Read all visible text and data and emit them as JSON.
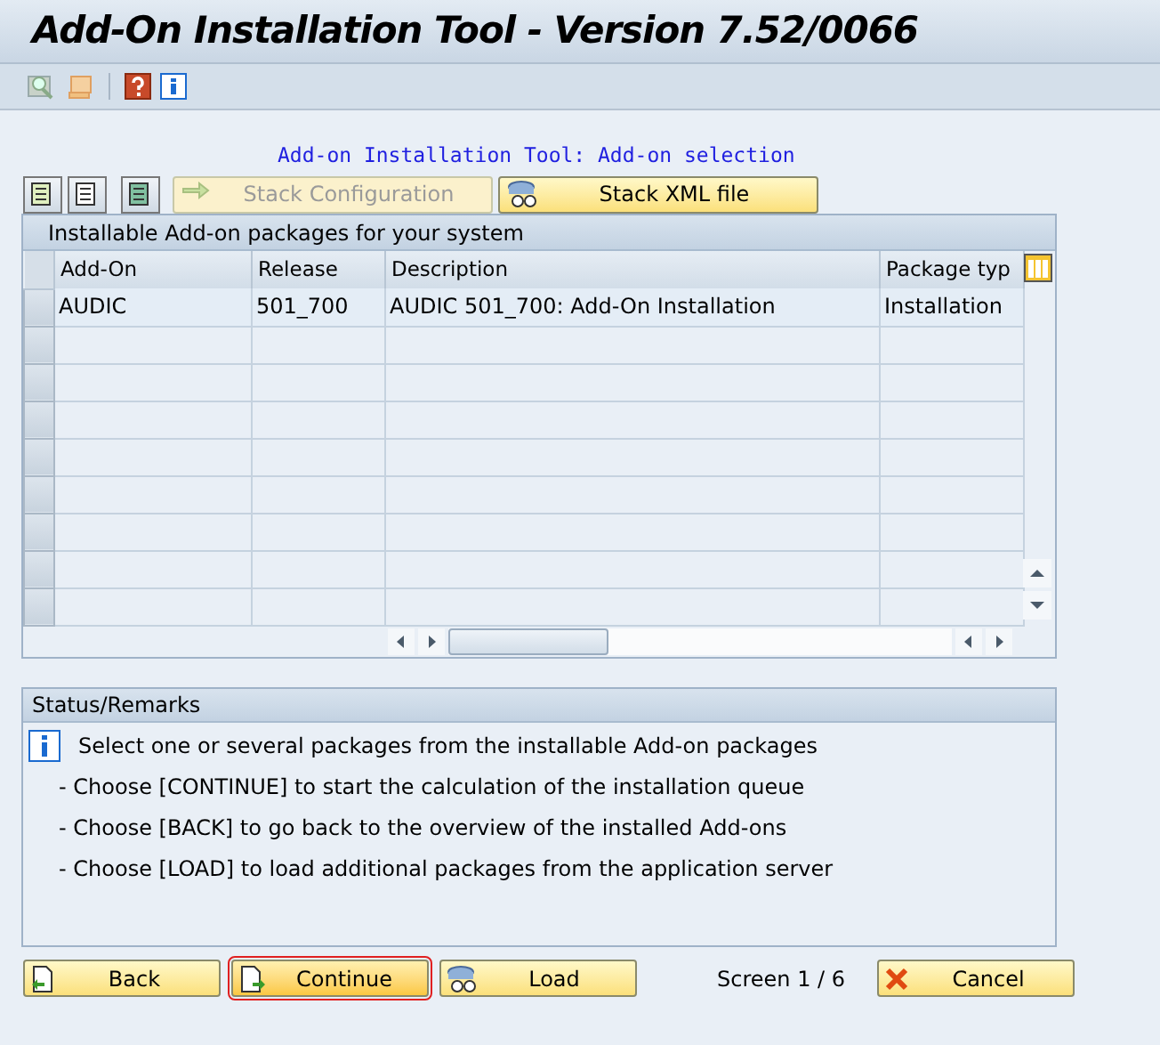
{
  "window": {
    "title": "Add-On Installation Tool - Version 7.52/0066"
  },
  "subtitle": "Add-on Installation Tool: Add-on selection",
  "table_buttons": [
    {
      "label": "Stack Configuration",
      "disabled": true,
      "kind": "arrow"
    },
    {
      "label": "Stack XML file",
      "disabled": false,
      "kind": "glasses"
    }
  ],
  "table": {
    "title": "Installable Add-on packages for your system",
    "columns": [
      "Add-On",
      "Release",
      "Description",
      "Package typ"
    ],
    "rows": [
      [
        "AUDIC",
        "501_700",
        "AUDIC 501_700: Add-On Installation",
        "Installation"
      ]
    ]
  },
  "status": {
    "title": "Status/Remarks",
    "lines": [
      {
        "kind": "info",
        "text": "Select one or several packages from the installable Add-on packages"
      },
      {
        "kind": "bullet",
        "text": "- Choose [CONTINUE] to start the calculation of the installation queue"
      },
      {
        "kind": "bullet",
        "text": "- Choose [BACK] to go back to the overview of the installed Add-ons"
      },
      {
        "kind": "bullet",
        "text": "- Choose [LOAD] to load additional packages from the application server"
      }
    ]
  },
  "footer": {
    "buttons": [
      {
        "label": "Back",
        "kind": "back",
        "focused": false
      },
      {
        "label": "Continue",
        "kind": "forward",
        "focused": true
      },
      {
        "label": "Load",
        "kind": "glasses",
        "focused": false
      }
    ],
    "screen": "Screen 1 / 6",
    "cancel": "Cancel"
  }
}
